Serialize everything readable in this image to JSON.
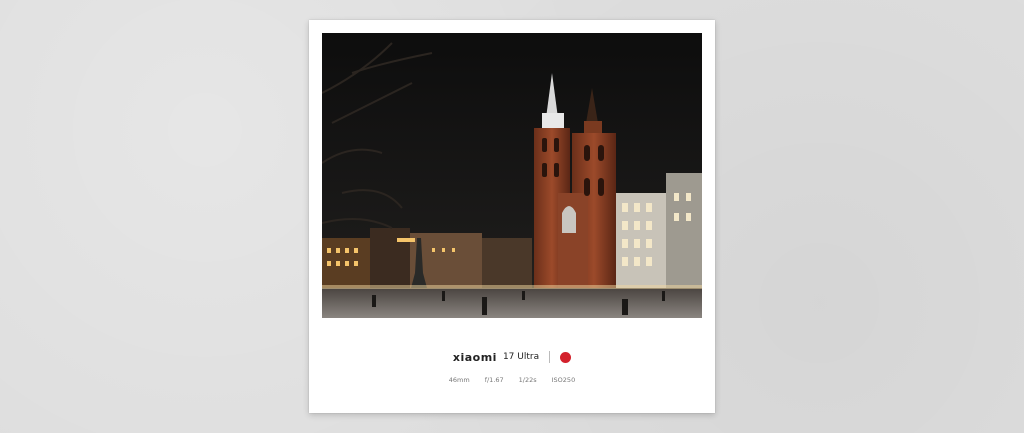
{
  "card": {
    "brand": "xiaomi",
    "model": "17 Ultra",
    "logo": "leica-red-dot-icon",
    "specs": {
      "focal_length": "46mm",
      "aperture": "f/1.67",
      "shutter": "1/22s",
      "iso": "ISO250"
    }
  },
  "photo": {
    "subject": "night-church-square-photo"
  },
  "colors": {
    "background": "#dedede",
    "card": "#ffffff",
    "accent": "#d3212c"
  }
}
